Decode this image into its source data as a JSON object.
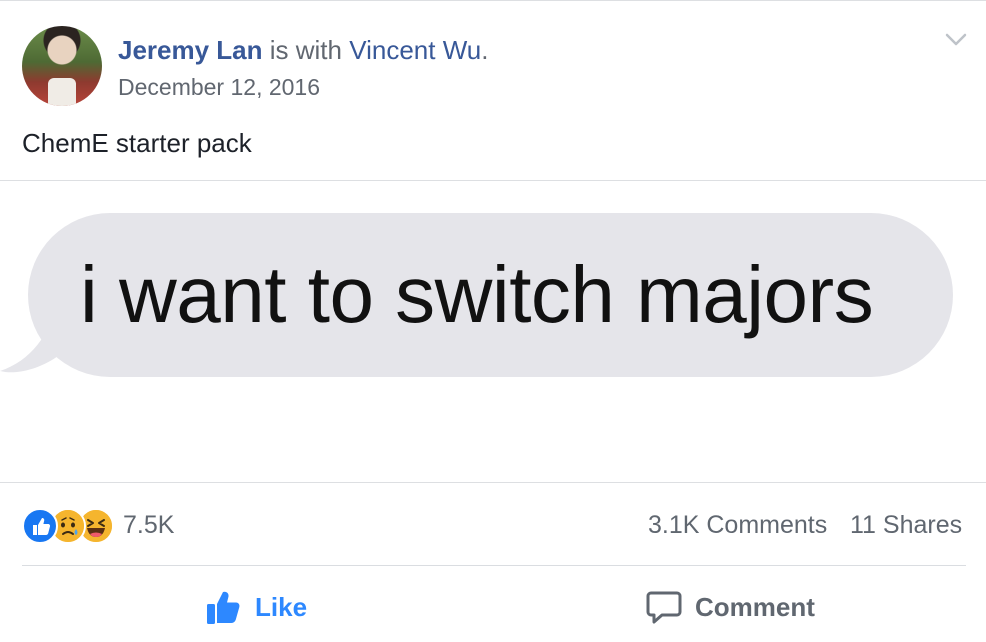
{
  "post": {
    "author": "Jeremy Lan",
    "with_text": " is with ",
    "tagged": "Vincent Wu",
    "tagged_suffix": ".",
    "date": "December 12, 2016",
    "text": "ChemE starter pack",
    "image_bubble_text": "i want to switch majors"
  },
  "stats": {
    "reactions": [
      "like-icon",
      "sad-icon",
      "haha-icon"
    ],
    "reaction_count": "7.5K",
    "comments": "3.1K Comments",
    "shares": "11 Shares"
  },
  "actions": {
    "like_label": "Like",
    "comment_label": "Comment"
  },
  "colors": {
    "link": "#385898",
    "secondary_text": "#616770",
    "like_blue": "#2d88ff",
    "bubble_gray": "#e5e5ea"
  }
}
